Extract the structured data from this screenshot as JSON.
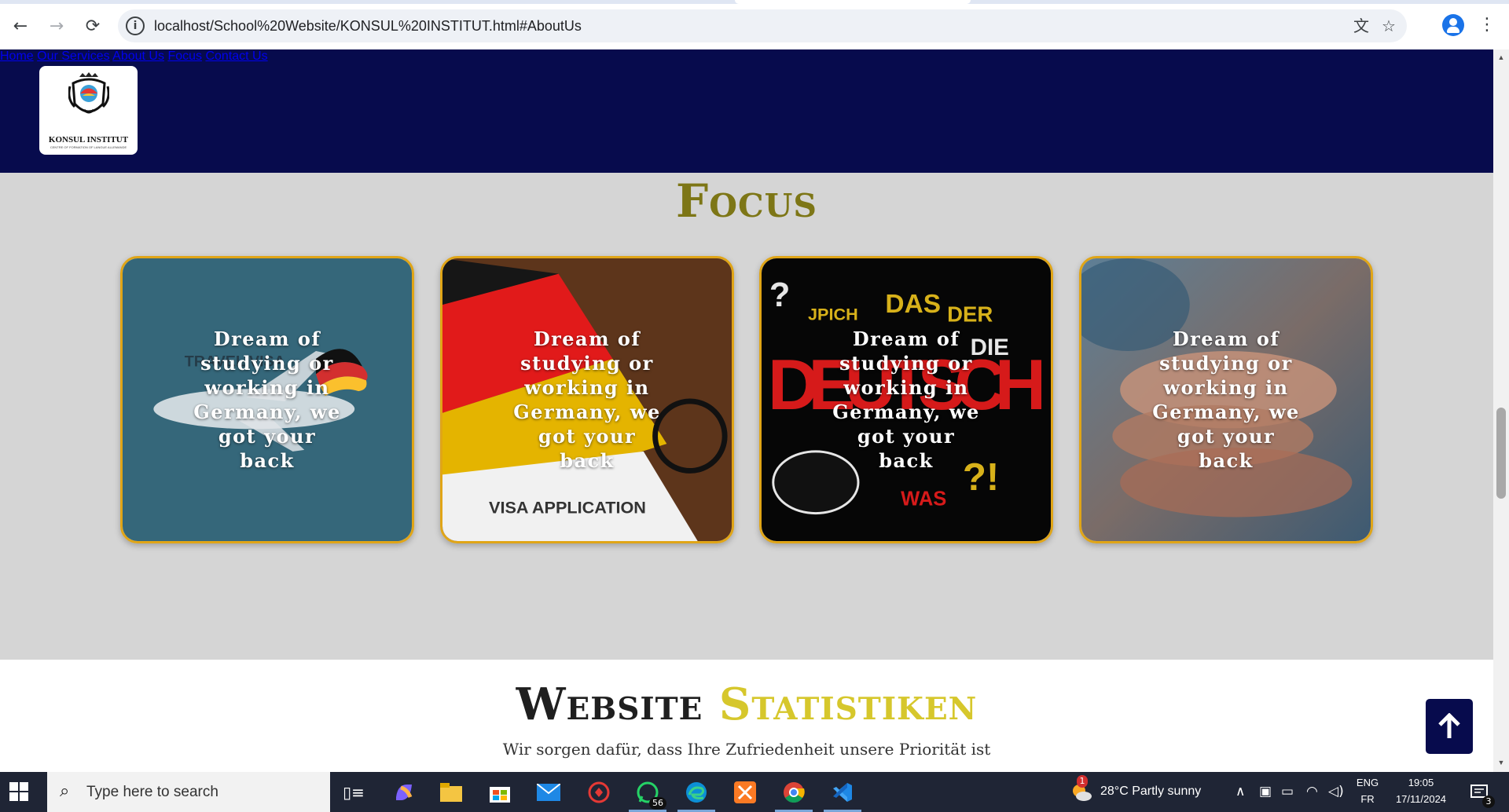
{
  "browser": {
    "url": "localhost/School%20Website/KONSUL%20INSTITUT.html#AboutUs",
    "back_icon": "←",
    "forward_icon": "→",
    "reload_icon": "⟳",
    "info_icon": "i",
    "translate_icon": "文",
    "bookmark_icon": "☆",
    "menu_icon": "⋮"
  },
  "site": {
    "logo_text": "KONSUL INSTITUT",
    "logo_subtext": "CENTRE OF FORMATION OF LANGUE ALLEMANDE",
    "nav": [
      {
        "label": "Home"
      },
      {
        "label": "Our Services"
      },
      {
        "label": "About Us"
      },
      {
        "label": "Focus"
      },
      {
        "label": "Contact Us"
      }
    ],
    "colors": {
      "header_bg": "#070b4d",
      "accent_gold": "#e0a517",
      "focus_title": "#7d7616",
      "stats_accent": "#d6c72c"
    }
  },
  "focus": {
    "title": "Focus",
    "cards": [
      {
        "caption": "Dream of studying or working in Germany, we got your back",
        "image": "airplane-travel",
        "overlay_text": "TRAVEL VISA"
      },
      {
        "caption": "Dream of studying or working in Germany, we got your back",
        "image": "visa-application",
        "overlay_text": "VISA APPLICATION"
      },
      {
        "caption": "Dream of studying or working in Germany, we got your back",
        "image": "deutsch-words",
        "overlay_text": "DEUTSCH"
      },
      {
        "caption": "Dream of studying or working in Germany, we got your back",
        "image": "joined-hands",
        "overlay_text": ""
      }
    ]
  },
  "stats": {
    "title_word1": "Website",
    "title_word2": "Statistiken",
    "subtitle": "Wir sorgen dafür, dass Ihre Zufriedenheit unsere Priorität ist"
  },
  "taskbar": {
    "search_placeholder": "Type here to search",
    "whatsapp_badge": "56",
    "weather_badge": "1",
    "weather": "28°C  Partly sunny",
    "lang_top": "ENG",
    "lang_bottom": "FR",
    "time": "19:05",
    "date": "17/11/2024",
    "notification_count": "3"
  }
}
